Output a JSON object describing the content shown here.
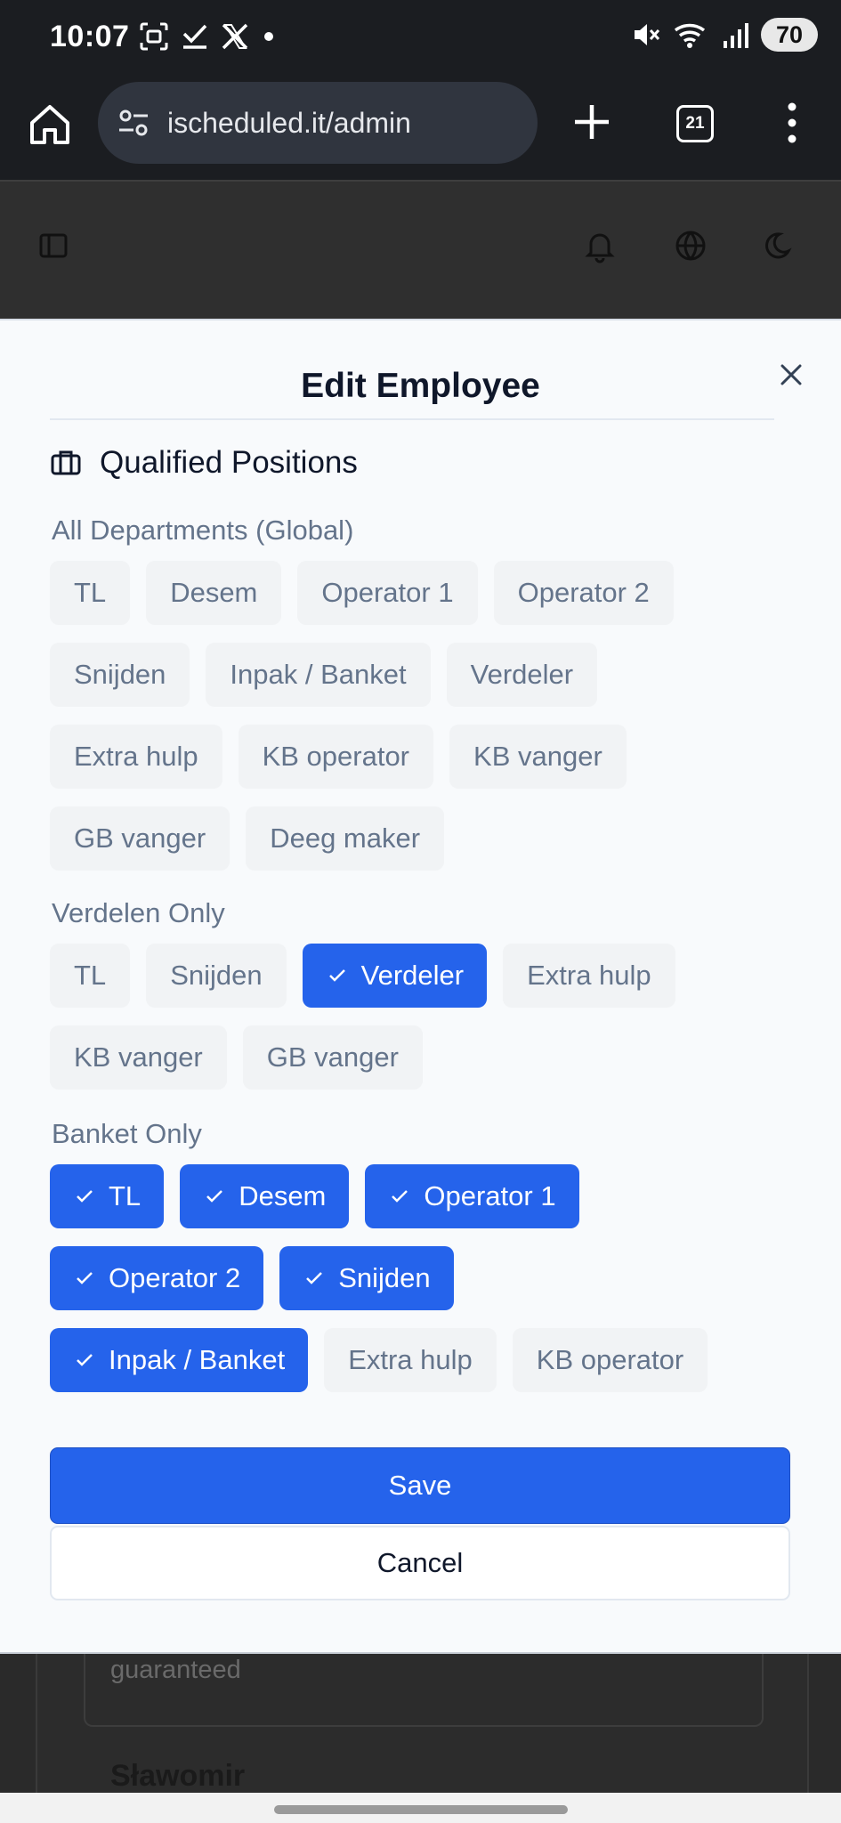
{
  "status_bar": {
    "time": "10:07",
    "battery": "70",
    "left_icons": [
      "screenshot-icon",
      "check-icon",
      "x-logo-icon",
      "dot-icon"
    ],
    "right_icons": [
      "mute-icon",
      "wifi-icon",
      "signal-icon"
    ]
  },
  "browser": {
    "url": "ischeduled.it/admin",
    "tab_count": "21"
  },
  "app_header": {
    "icons": [
      "sidebar-toggle-icon",
      "bell-icon",
      "globe-icon",
      "moon-icon"
    ]
  },
  "modal": {
    "title": "Edit Employee",
    "section_title": "Qualified Positions",
    "groups": [
      {
        "label": "All Departments (Global)",
        "chips": [
          {
            "label": "TL",
            "selected": false
          },
          {
            "label": "Desem",
            "selected": false
          },
          {
            "label": "Operator 1",
            "selected": false
          },
          {
            "label": "Operator 2",
            "selected": false
          },
          {
            "label": "Snijden",
            "selected": false
          },
          {
            "label": "Inpak / Banket",
            "selected": false
          },
          {
            "label": "Verdeler",
            "selected": false
          },
          {
            "label": "Extra hulp",
            "selected": false
          },
          {
            "label": "KB operator",
            "selected": false
          },
          {
            "label": "KB vanger",
            "selected": false
          },
          {
            "label": "GB vanger",
            "selected": false
          },
          {
            "label": "Deeg maker",
            "selected": false
          }
        ]
      },
      {
        "label": "Verdelen Only",
        "chips": [
          {
            "label": "TL",
            "selected": false
          },
          {
            "label": "Snijden",
            "selected": false
          },
          {
            "label": "Verdeler",
            "selected": true
          },
          {
            "label": "Extra hulp",
            "selected": false
          },
          {
            "label": "KB vanger",
            "selected": false
          },
          {
            "label": "GB vanger",
            "selected": false
          }
        ]
      },
      {
        "label": "Banket Only",
        "chips": [
          {
            "label": "TL",
            "selected": true
          },
          {
            "label": "Desem",
            "selected": true
          },
          {
            "label": "Operator 1",
            "selected": true
          },
          {
            "label": "Operator 2",
            "selected": true
          },
          {
            "label": "Snijden",
            "selected": true
          },
          {
            "label": "Inpak / Banket",
            "selected": true
          },
          {
            "label": "Extra hulp",
            "selected": false
          },
          {
            "label": "KB operator",
            "selected": false
          }
        ]
      }
    ],
    "save_label": "Save",
    "cancel_label": "Cancel"
  },
  "background": {
    "guaranteed_text": "guaranteed",
    "employee_name": "Sławomir"
  },
  "colors": {
    "accent": "#2563eb",
    "chip_bg": "#f1f3f5",
    "chip_text": "#64748b",
    "title_text": "#0f172a"
  }
}
